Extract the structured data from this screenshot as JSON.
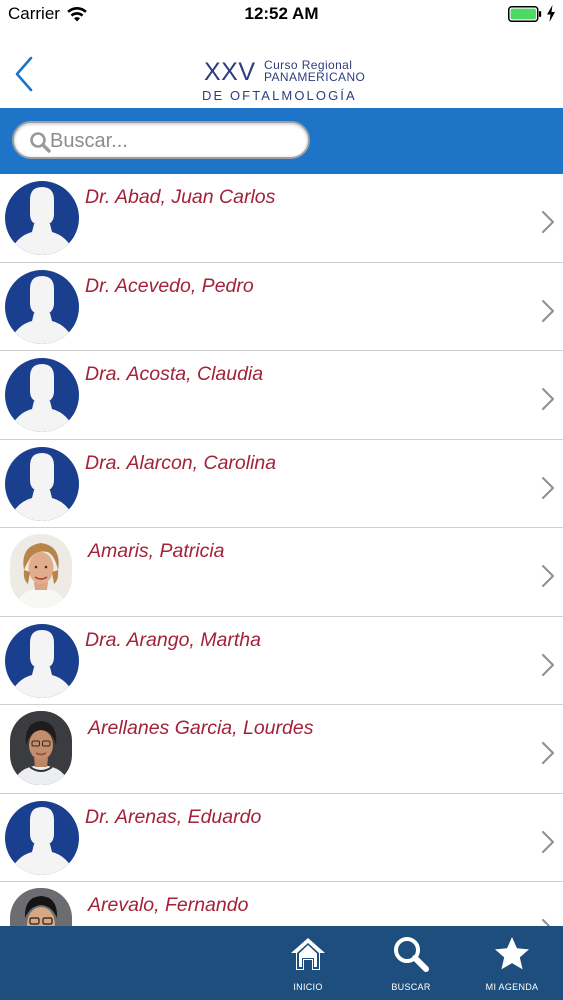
{
  "status_bar": {
    "carrier": "Carrier",
    "time": "12:52 AM",
    "battery_color": "#4cd964"
  },
  "header": {
    "back_icon": "chevron-left-icon",
    "logo": {
      "numeral": "XXV",
      "line1": "Curso Regional",
      "line2": "PANAMERICANO",
      "line3": "DE OFTALMOLOGÍA"
    }
  },
  "search": {
    "placeholder": "Buscar...",
    "value": "",
    "icon": "search-icon"
  },
  "speakers": [
    {
      "name": "Dr. Abad, Juan Carlos",
      "avatar": "placeholder"
    },
    {
      "name": "Dr. Acevedo, Pedro",
      "avatar": "placeholder"
    },
    {
      "name": "Dra. Acosta, Claudia",
      "avatar": "placeholder"
    },
    {
      "name": "Dra. Alarcon, Carolina",
      "avatar": "placeholder"
    },
    {
      "name": "Amaris, Patricia",
      "avatar": "photo"
    },
    {
      "name": "Dra. Arango, Martha",
      "avatar": "placeholder"
    },
    {
      "name": "Arellanes Garcia, Lourdes",
      "avatar": "photo"
    },
    {
      "name": "Dr. Arenas, Eduardo",
      "avatar": "placeholder"
    },
    {
      "name": "Arevalo, Fernando",
      "avatar": "photo"
    }
  ],
  "tab_bar": {
    "tabs": [
      {
        "label": "INICIO",
        "icon": "home-icon"
      },
      {
        "label": "BUSCAR",
        "icon": "search-icon"
      },
      {
        "label": "MI AGENDA",
        "icon": "star-icon"
      }
    ]
  },
  "colors": {
    "accent_blue": "#1e74c6",
    "tab_bar": "#1e4e7d",
    "name_red": "#a3223a",
    "logo_navy": "#2e3d7d",
    "avatar_blue": "#1b3f8f"
  }
}
